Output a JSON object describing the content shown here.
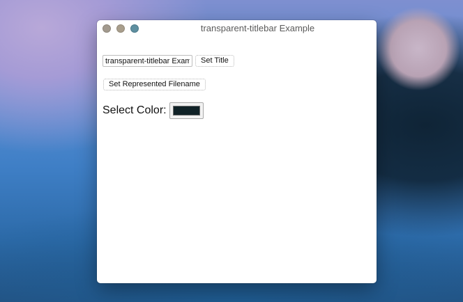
{
  "window": {
    "title": "transparent-titlebar Example"
  },
  "controls": {
    "title_input_value": "transparent-titlebar Example",
    "set_title_label": "Set Title",
    "set_represented_filename_label": "Set Represented Filename",
    "select_color_label": "Select Color:",
    "selected_color": "#102227"
  },
  "icons": [
    "close-icon",
    "minimize-icon",
    "maximize-icon"
  ]
}
